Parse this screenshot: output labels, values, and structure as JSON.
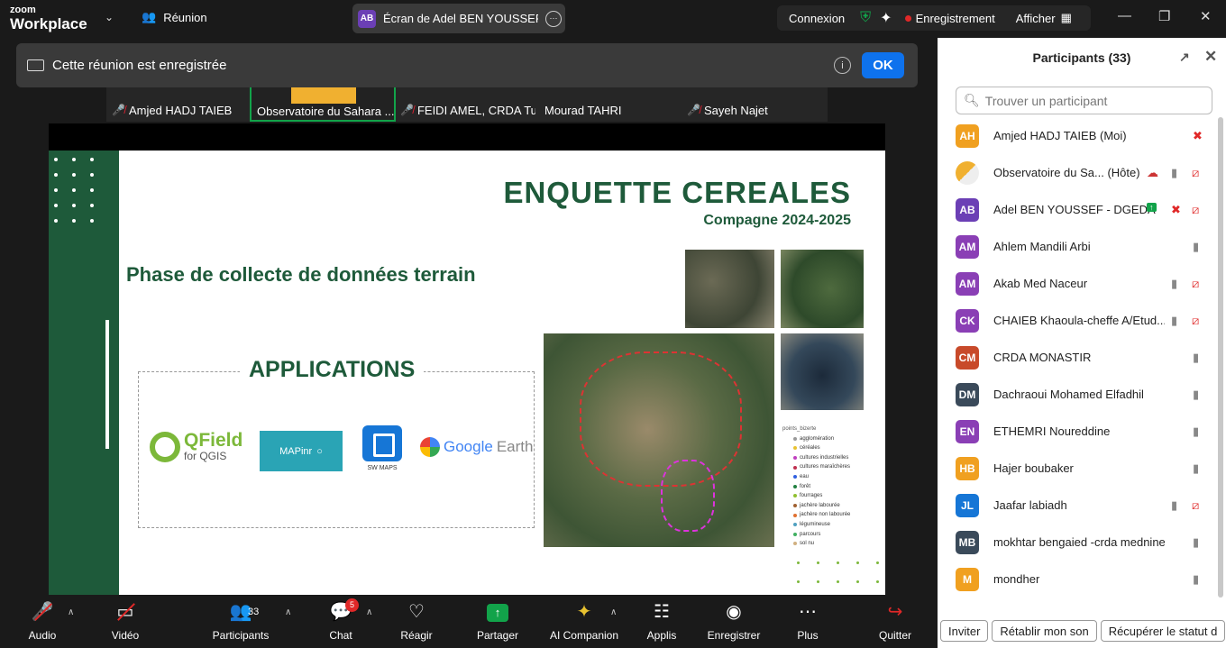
{
  "app": {
    "logo_line1": "zoom",
    "logo_line2": "Workplace",
    "meeting_label": "Réunion"
  },
  "share_tab": {
    "initials": "AB",
    "title": "Écran de Adel BEN YOUSSEF - DGEDA"
  },
  "top_right": {
    "connexion": "Connexion",
    "recording": "Enregistrement",
    "afficher": "Afficher"
  },
  "banner": {
    "text": "Cette réunion est enregistrée",
    "ok": "OK"
  },
  "thumbs": [
    {
      "name": "Amjed HADJ TAIEB",
      "muted": true
    },
    {
      "name": "Observatoire du Sahara ...",
      "muted": false
    },
    {
      "name": "FEIDI AMEL, CRDA Tu...",
      "muted": true
    },
    {
      "name": "Mourad TAHRI",
      "muted": false
    },
    {
      "name": "Sayeh Najet",
      "muted": true
    }
  ],
  "slide": {
    "title": "ENQUETTE CEREALES",
    "subtitle": "Compagne 2024-2025",
    "phase": "Phase de collecte de données terrain",
    "applications_title": "APPLICATIONS",
    "qfield_a": "QField",
    "qfield_b": "for QGIS",
    "mapinr": "MAPinr",
    "swmaps": "SW MAPS",
    "google": "Google",
    "earth": "Earth",
    "legend_header": "points_bizerte",
    "legend": [
      {
        "label": "agglomération",
        "color": "#999999"
      },
      {
        "label": "céréales",
        "color": "#e8c230"
      },
      {
        "label": "cultures industrielles",
        "color": "#c040c0"
      },
      {
        "label": "cultures maraîchères",
        "color": "#c03050"
      },
      {
        "label": "eau",
        "color": "#3060e0"
      },
      {
        "label": "forêt",
        "color": "#208040"
      },
      {
        "label": "fourrages",
        "color": "#90c030"
      },
      {
        "label": "jachère labourée",
        "color": "#a06030"
      },
      {
        "label": "jachère non labourée",
        "color": "#e07030"
      },
      {
        "label": "légumineuse",
        "color": "#50a0c0"
      },
      {
        "label": "parcours",
        "color": "#40b060"
      },
      {
        "label": "sol nu",
        "color": "#d0b080"
      }
    ]
  },
  "toolbar": {
    "audio": "Audio",
    "video": "Vidéo",
    "participants": "Participants",
    "participants_count": "33",
    "chat": "Chat",
    "chat_badge": "5",
    "react": "Réagir",
    "share": "Partager",
    "ai": "AI Companion",
    "apps": "Applis",
    "record": "Enregistrer",
    "more": "Plus",
    "quit": "Quitter"
  },
  "panel": {
    "title": "Participants (33)",
    "search_placeholder": "Trouver un participant",
    "participants": [
      {
        "initials": "AH",
        "name": "Amjed HADJ TAIEB (Moi)",
        "color": "#f0a020",
        "mic": "muted",
        "video": "none"
      },
      {
        "initials": "",
        "name": "Observatoire du Sa...  (Hôte)",
        "color": "#ffffff",
        "mic": "on",
        "video": "off",
        "cloud": true
      },
      {
        "initials": "AB",
        "name": "Adel BEN YOUSSEF - DGEDA",
        "color": "#6b3fb5",
        "mic": "muted",
        "video": "off",
        "sharing": true
      },
      {
        "initials": "AM",
        "name": "Ahlem Mandili Arbi",
        "color": "#8a3fb5",
        "mic": "on",
        "video": "none"
      },
      {
        "initials": "AM",
        "name": "Akab Med Naceur",
        "color": "#8a3fb5",
        "mic": "on",
        "video": "off"
      },
      {
        "initials": "CK",
        "name": "CHAIEB Khaoula-cheffe A/Etud...",
        "color": "#8a3fb5",
        "mic": "on",
        "video": "off"
      },
      {
        "initials": "CM",
        "name": "CRDA MONASTIR",
        "color": "#c84a2a",
        "mic": "on",
        "video": "none"
      },
      {
        "initials": "DM",
        "name": "Dachraoui Mohamed Elfadhil",
        "color": "#3a4a5a",
        "mic": "on",
        "video": "none"
      },
      {
        "initials": "EN",
        "name": "ETHEMRI Noureddine",
        "color": "#8a3fb5",
        "mic": "on",
        "video": "none"
      },
      {
        "initials": "HB",
        "name": "Hajer boubaker",
        "color": "#f0a020",
        "mic": "on",
        "video": "none"
      },
      {
        "initials": "JL",
        "name": "Jaafar labiadh",
        "color": "#1676d6",
        "mic": "on",
        "video": "off"
      },
      {
        "initials": "MB",
        "name": "mokhtar bengaied -crda mednine",
        "color": "#3a4a5a",
        "mic": "on",
        "video": "none"
      },
      {
        "initials": "M",
        "name": "mondher",
        "color": "#f0a020",
        "mic": "on",
        "video": "none"
      }
    ],
    "footer": {
      "invite": "Inviter",
      "mute_restore": "Rétablir mon son",
      "recover": "Récupérer le statut d"
    }
  }
}
